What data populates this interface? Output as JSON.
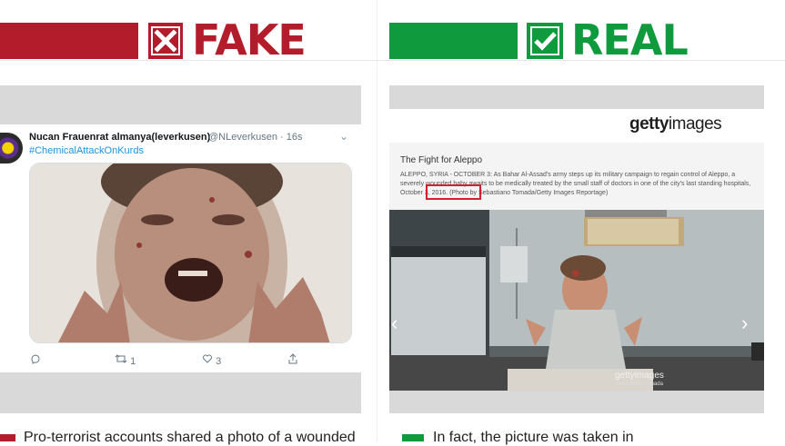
{
  "header": {
    "fake_label": "FAKE",
    "real_label": "REAL",
    "fake_color": "#b31d2b",
    "real_color": "#109a3e"
  },
  "tweet": {
    "display_name": "Nucan Frauenrat almanya(leverkusen)",
    "handle_time": "@NLeverkusen · 16s",
    "hashtag": "#ChemicalAttackOnKurds",
    "retweets": "1",
    "likes": "3",
    "icons": [
      "reply-icon",
      "retweet-icon",
      "heart-icon",
      "share-icon",
      "chevron-down-icon"
    ]
  },
  "getty": {
    "logo_bold": "getty",
    "logo_light": "images",
    "caption_title": "The Fight for Aleppo",
    "caption_text": "ALEPPO, SYRIA - OCTOBER 3: As Bahar Al-Assad's army steps up its military campaign to regain control of Aleppo, a severely wounded baby awaits to be medically treated by the small staff of doctors in one of the city's last standing hospitals, October 3, 2016. (Photo by Sebastiano Tomada/Getty Images Reportage)",
    "watermark": "gettyimages",
    "watermark_credit": "Sebastiano Tomada"
  },
  "bottom": {
    "left_text": "Pro-terrorist accounts shared a photo of a wounded",
    "right_text": "In fact, the picture was taken in"
  }
}
